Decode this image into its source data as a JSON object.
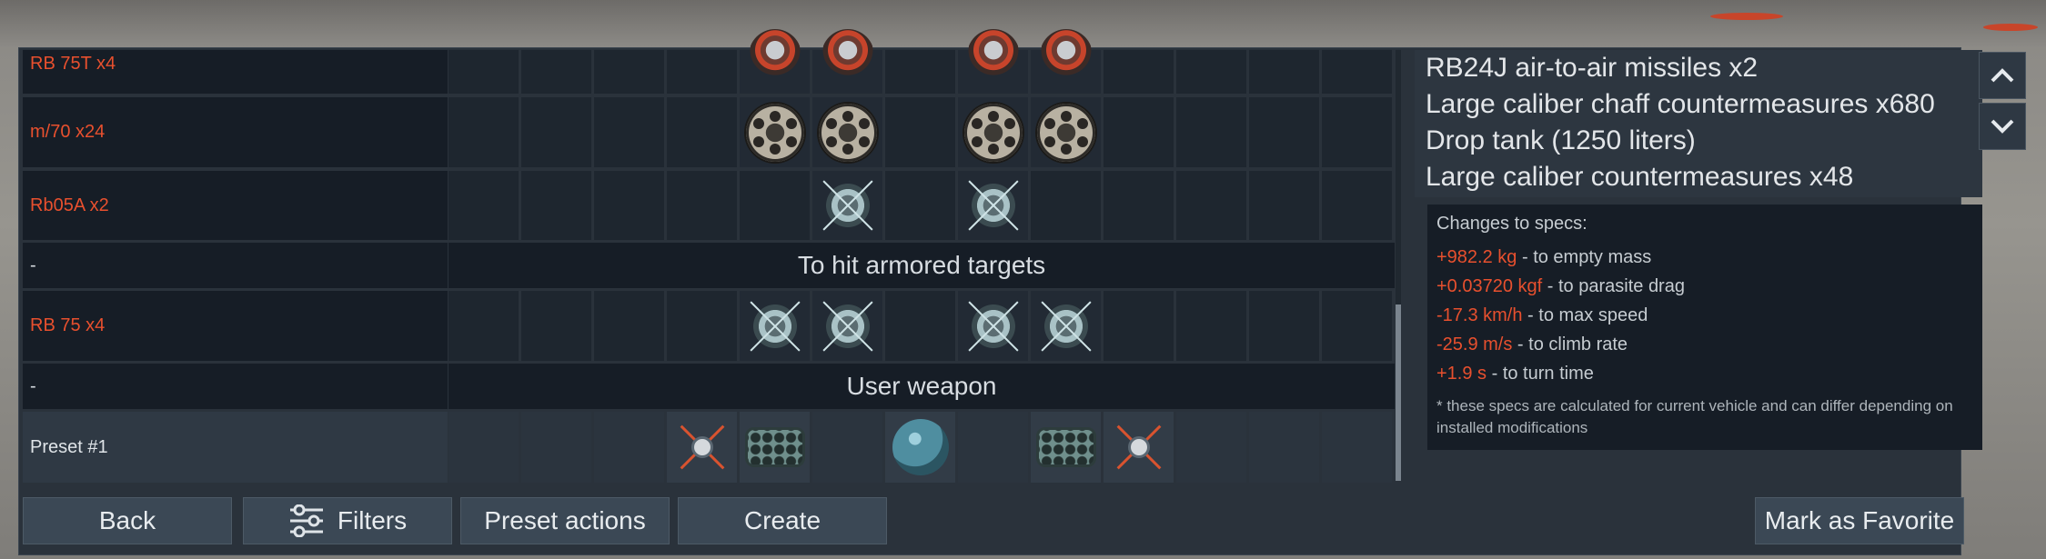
{
  "weapon_rows": [
    {
      "label": "RB 75T x4"
    },
    {
      "label": "m/70 x24"
    },
    {
      "label": "Rb05A x2"
    }
  ],
  "section_armored": {
    "dash": "-",
    "title": "To hit armored targets"
  },
  "row_rb75": {
    "label": "RB 75 x4"
  },
  "section_user": {
    "dash": "-",
    "title": "User weapon"
  },
  "preset": {
    "label": "Preset #1"
  },
  "selected_items": [
    "RB24J air-to-air missiles x2",
    "Large caliber chaff countermeasures x680",
    "Drop tank (1250 liters)",
    "Large caliber countermeasures x48"
  ],
  "specs": {
    "heading": "Changes to specs:",
    "items": [
      {
        "value": "+982.2 kg",
        "label": " - to empty mass"
      },
      {
        "value": "+0.03720 kgf",
        "label": " - to parasite drag"
      },
      {
        "value": "-17.3 km/h",
        "label": " - to max speed"
      },
      {
        "value": "-25.9 m/s",
        "label": " - to climb rate"
      },
      {
        "value": "+1.9 s",
        "label": " - to turn time"
      }
    ],
    "note": "* these specs are calculated for current vehicle and can differ depending on installed modifications"
  },
  "buttons": {
    "back": "Back",
    "filters": "Filters",
    "preset_actions": "Preset actions",
    "create": "Create",
    "favorite": "Mark as Favorite"
  },
  "icons": {
    "up": "chevron-up-icon",
    "down": "chevron-down-icon",
    "filters": "sliders-icon"
  },
  "colors": {
    "accent_red": "#e8502e",
    "panel": "#2a323b"
  }
}
